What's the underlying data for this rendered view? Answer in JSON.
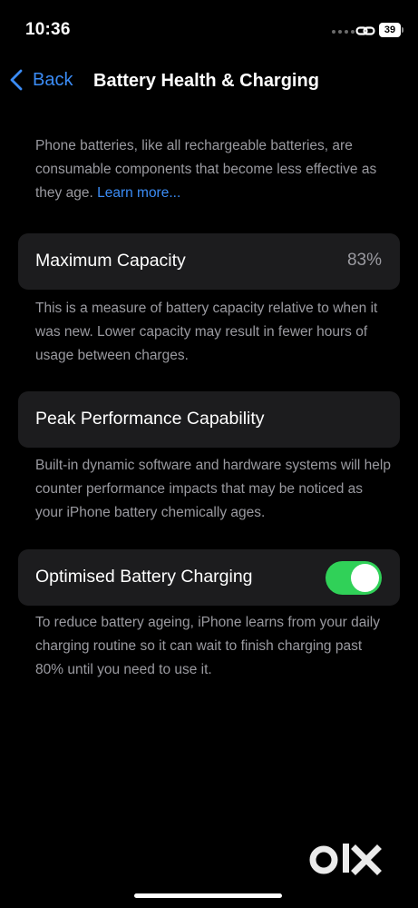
{
  "status_bar": {
    "time": "10:36",
    "battery_level": "39",
    "icons": [
      "signal-dots-icon",
      "link-icon",
      "battery-icon"
    ]
  },
  "nav": {
    "back_label": "Back",
    "title": "Battery Health & Charging"
  },
  "intro": {
    "text": "Phone batteries, like all rechargeable batteries, are consumable components that become less effective as they age. ",
    "link": "Learn more..."
  },
  "max_capacity": {
    "label": "Maximum Capacity",
    "value": "83%",
    "description": "This is a measure of battery capacity relative to when it was new. Lower capacity may result in fewer hours of usage between charges."
  },
  "peak_performance": {
    "label": "Peak Performance Capability",
    "description": "Built-in dynamic software and hardware systems will help counter performance impacts that may be noticed as your iPhone battery chemically ages."
  },
  "optimised_charging": {
    "label": "Optimised Battery Charging",
    "enabled": true,
    "description": "To reduce battery ageing, iPhone learns from your daily charging routine so it can wait to finish charging past 80% until you need to use it."
  },
  "colors": {
    "background": "#000000",
    "card": "#1c1c1e",
    "accent": "#3b8cf6",
    "toggle_on": "#30d158",
    "secondary_text": "#9a9aa0"
  },
  "watermark": {
    "text": "OLX"
  }
}
